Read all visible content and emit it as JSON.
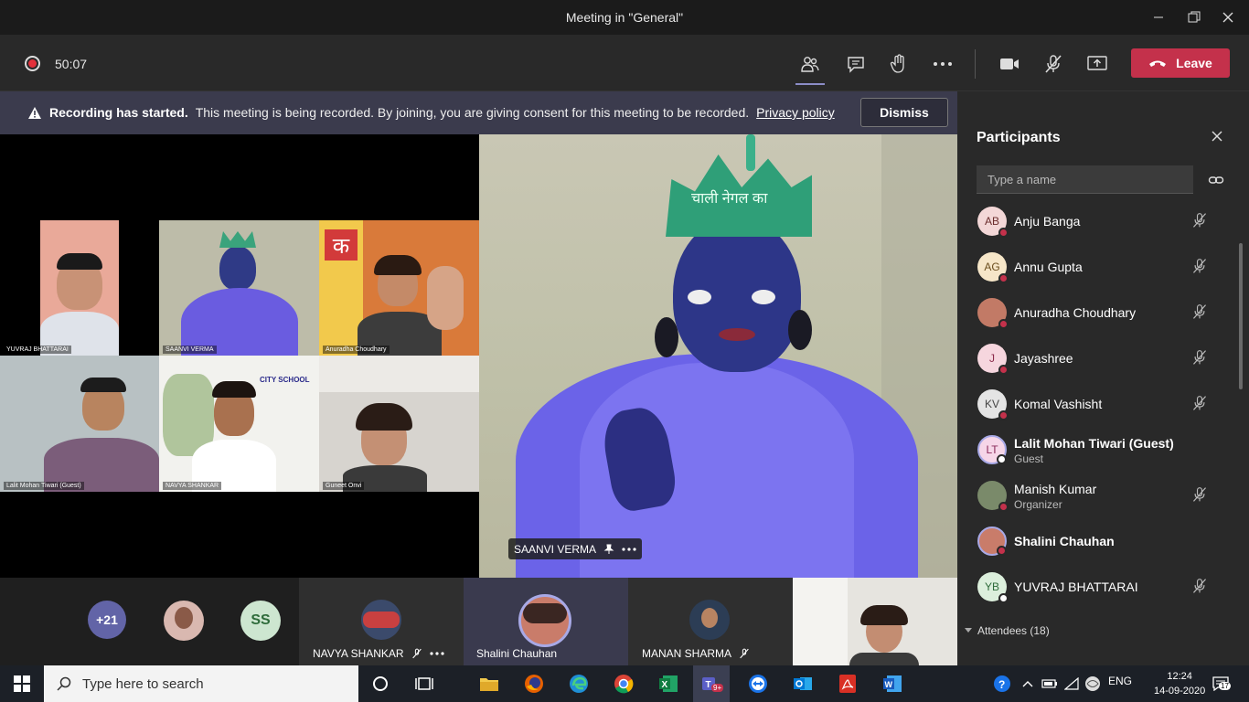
{
  "window": {
    "title": "Meeting in \"General\""
  },
  "toolbar": {
    "timer": "50:07",
    "leave_label": "Leave"
  },
  "banner": {
    "bold": "Recording has started.",
    "message": "This meeting is being recorded. By joining, you are giving consent for this meeting to be recorded.",
    "link": "Privacy policy",
    "dismiss": "Dismiss"
  },
  "gallery": {
    "tiles": [
      {
        "label": "YUVRAJ BHATTARAI"
      },
      {
        "label": "SAANVI VERMA"
      },
      {
        "label": "Anuradha Choudhary"
      },
      {
        "label": "Lalit Mohan Tiwari (Guest)"
      },
      {
        "label": "NAVYA SHANKAR"
      },
      {
        "label": "Guneet Onvi"
      }
    ],
    "school_badge": "CITY SCHOOL",
    "crown_text": "चाली नेगल का"
  },
  "spotlight": {
    "name": "SAANVI VERMA"
  },
  "strip": {
    "more_count": "+21",
    "ss_initials": "SS",
    "navya": "NAVYA SHANKAR",
    "shalini": "Shalini Chauhan",
    "manan": "MANAN SHARMA"
  },
  "participants": {
    "title": "Participants",
    "search_placeholder": "Type a name",
    "items": [
      {
        "initials": "AB",
        "name": "Anju Banga",
        "role": ""
      },
      {
        "initials": "AG",
        "name": "Annu Gupta",
        "role": ""
      },
      {
        "initials": "",
        "name": "Anuradha Choudhary",
        "role": ""
      },
      {
        "initials": "J",
        "name": "Jayashree",
        "role": ""
      },
      {
        "initials": "KV",
        "name": "Komal Vashisht",
        "role": ""
      },
      {
        "initials": "LT",
        "name": "Lalit Mohan Tiwari (Guest)",
        "role": "Guest"
      },
      {
        "initials": "",
        "name": "Manish Kumar",
        "role": "Organizer"
      },
      {
        "initials": "",
        "name": "Shalini Chauhan",
        "role": ""
      },
      {
        "initials": "YB",
        "name": "YUVRAJ BHATTARAI",
        "role": ""
      }
    ],
    "attendees": "Attendees (18)"
  },
  "taskbar": {
    "search_placeholder": "Type here to search",
    "language": "ENG",
    "time": "12:24",
    "date": "14-09-2020",
    "notifications": "17",
    "teams_badge": "9+"
  }
}
